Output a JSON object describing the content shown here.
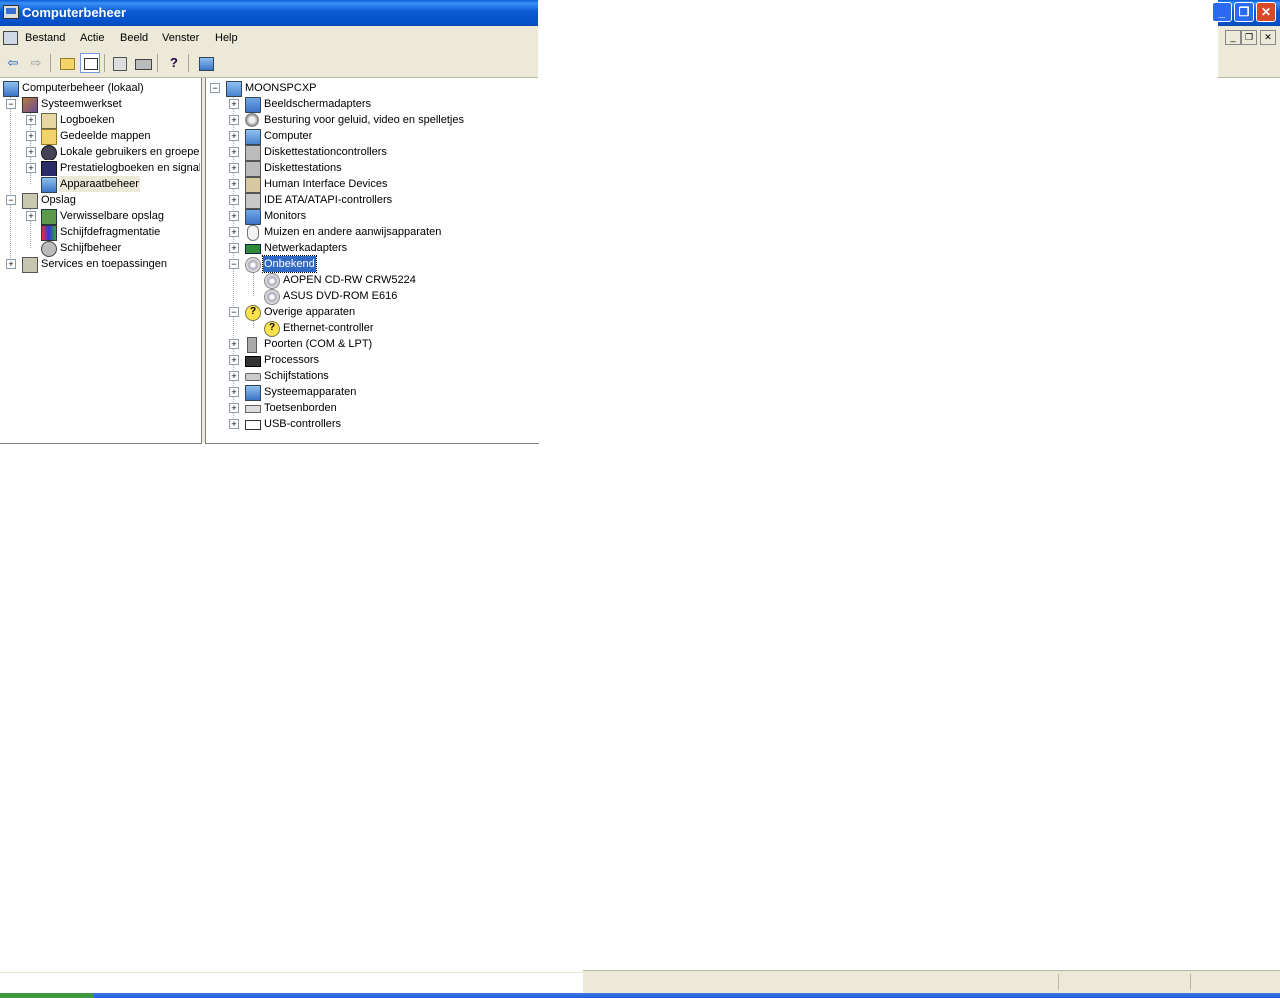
{
  "window": {
    "title": "Computerbeheer",
    "caption_min": "_",
    "caption_max": "❐",
    "caption_close": "✕"
  },
  "menu": [
    "Bestand",
    "Actie",
    "Beeld",
    "Venster",
    "Help"
  ],
  "mdi": {
    "min": "_",
    "restore": "❐",
    "close": "✕"
  },
  "toolbar": {
    "buttons": [
      "back-icon",
      "forward-icon",
      "up-folder-icon",
      "show-hide-tree-icon",
      "properties-icon",
      "print-icon",
      "help-icon",
      "device-manager-icon"
    ]
  },
  "left_tree": {
    "root": "Computerbeheer (lokaal)",
    "items": [
      {
        "label": "Systeemwerkset",
        "icon": "tools-icon"
      },
      {
        "label": "Logboeken",
        "icon": "log-icon"
      },
      {
        "label": "Gedeelde mappen",
        "icon": "folder-icon"
      },
      {
        "label": "Lokale gebruikers en groepen",
        "icon": "users-icon"
      },
      {
        "label": "Prestatielogboeken en signalen",
        "icon": "performance-icon"
      },
      {
        "label": "Apparaatbeheer",
        "icon": "device-manager-icon"
      },
      {
        "label": "Opslag",
        "icon": "storage-icon"
      },
      {
        "label": "Verwisselbare opslag",
        "icon": "removable-storage-icon"
      },
      {
        "label": "Schijfdefragmentatie",
        "icon": "defrag-icon"
      },
      {
        "label": "Schijfbeheer",
        "icon": "disk-management-icon"
      },
      {
        "label": "Services en toepassingen",
        "icon": "services-icon"
      }
    ]
  },
  "right_tree": {
    "root": "MOONSPCXP",
    "items": [
      "Beeldschermadapters",
      "Besturing voor geluid, video en spelletjes",
      "Computer",
      "Diskettestationcontrollers",
      "Diskettestations",
      "Human Interface Devices",
      "IDE ATA/ATAPI-controllers",
      "Monitors",
      "Muizen en andere aanwijsapparaten",
      "Netwerkadapters",
      "Onbekend",
      "AOPEN CD-RW CRW5224",
      "ASUS DVD-ROM E616",
      "Overige apparaten",
      "Ethernet-controller",
      "Poorten (COM & LPT)",
      "Processors",
      "Schijfstations",
      "Systeemapparaten",
      "Toetsenborden",
      "USB-controllers"
    ]
  },
  "colors": {
    "titlebar": "#0b5ad4",
    "selection": "#316ac5",
    "chrome": "#ece9d8"
  }
}
